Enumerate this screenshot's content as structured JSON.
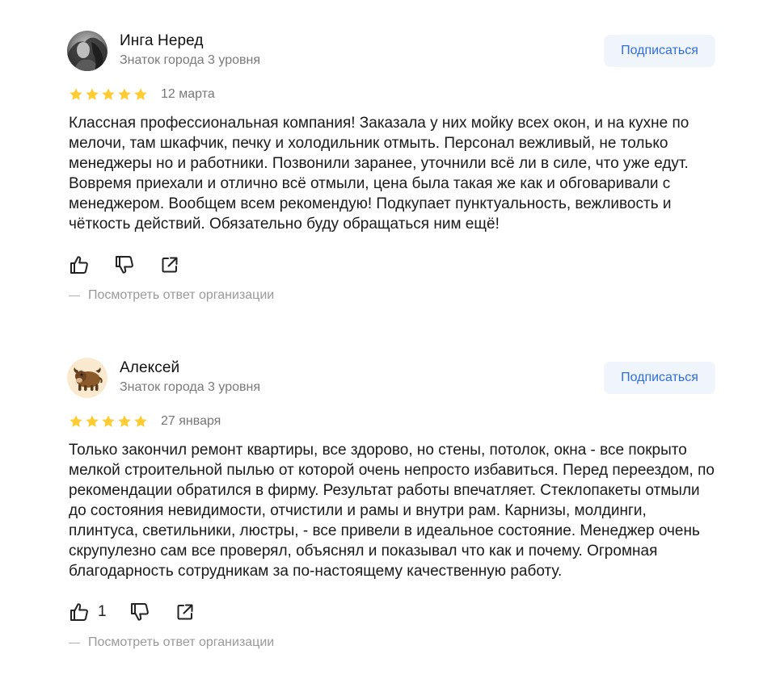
{
  "reviews": [
    {
      "author": "Инга Неред",
      "level": "Знаток города 3 уровня",
      "subscribe_label": "Подписаться",
      "rating": 5,
      "date": "12 марта",
      "text": "Классная профессиональная компания! Заказала у них мойку всех окон, и на кухне по мелочи, там шкафчик, печку и холодильник отмыть. Персонал вежливый, не только менеджеры но и работники. Позвонили заранее, уточнили всё ли в силе, что уже едут. Вовремя приехали и отлично всё отмыли, цена была такая же как и обговаривали с менеджером. Вообщем всем рекомендую! Подкупает пунктуальность, вежливость и чёткость действий. Обязательно буду обращаться ним ещё!",
      "likes": "",
      "org_reply_label": "Посмотреть ответ организации",
      "avatar_icon": "user-photo"
    },
    {
      "author": "Алексей",
      "level": "Знаток города 3 уровня",
      "subscribe_label": "Подписаться",
      "rating": 5,
      "date": "27 января",
      "text": "Только закончил ремонт квартиры, все здорово, но стены, потолок, окна - все покрыто мелкой строительной пылью от которой очень непросто избавиться. Перед переездом, по рекомендации обратился в фирму. Результат работы впечатляет. Стеклопакеты отмыли до состояния невидимости, отчистили и рамы и внутри рам. Карнизы, молдинги, плинтуса, светильники, люстры, - все привели в идеальное состояние. Менеджер очень скрупулезно сам все проверял, объяснял и показывал что как и почему. Огромная благодарность сотрудникам за по-настоящему качественную работу.",
      "likes": "1",
      "org_reply_label": "Посмотреть ответ организации",
      "avatar_icon": "yak-avatar"
    }
  ],
  "colors": {
    "star": "#fc3",
    "subscribe_bg": "#f0f4fb",
    "subscribe_text": "#2e6fdb",
    "muted": "#7a7a7a"
  }
}
